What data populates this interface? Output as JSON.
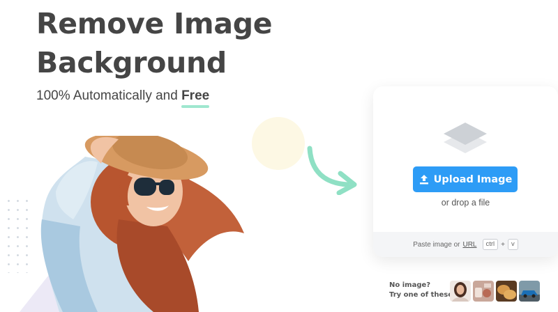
{
  "hero": {
    "title": "Remove Image Background",
    "subtitle_prefix": "100% Automatically and ",
    "subtitle_emphasis": "Free"
  },
  "upload": {
    "button_label": "Upload Image",
    "drop_text": "or drop a file",
    "paste_prefix": "Paste image or",
    "url_link": "URL",
    "shortcut_key1": "ctrl",
    "shortcut_plus": "+",
    "shortcut_key2": "v"
  },
  "samples": {
    "label_line1": "No image?",
    "label_line2": "Try one of these:",
    "thumbnails": [
      "sample-woman-image",
      "sample-objects-image",
      "sample-bread-image",
      "sample-car-image"
    ]
  },
  "colors": {
    "accent": "#2d9cf6",
    "underline": "#9fe7cf",
    "heading": "#454545",
    "arrow": "#8fe0c4"
  }
}
